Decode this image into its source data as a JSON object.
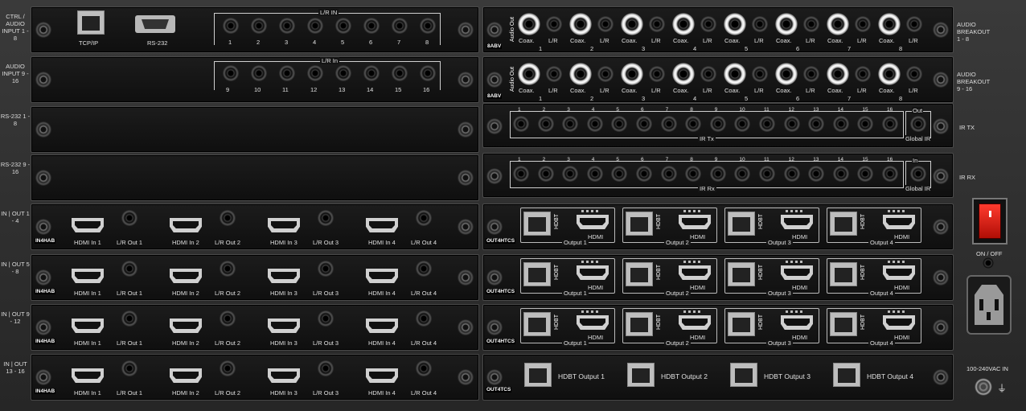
{
  "left_rows": [
    {
      "label": "CTRL / AUDIO INPUT 1 - 8"
    },
    {
      "label": "AUDIO INPUT 9 - 16"
    },
    {
      "label": "RS-232 1 - 8"
    },
    {
      "label": "RS-232 9 - 16"
    },
    {
      "label": "IN | OUT 1 - 4"
    },
    {
      "label": "IN | OUT 5 - 8"
    },
    {
      "label": "IN | OUT 9 - 12"
    },
    {
      "label": "IN | OUT 13 - 16"
    }
  ],
  "ctrl_card": {
    "tcpip": "TCP/IP",
    "rs232": "RS-232",
    "lr_in": "L/R IN",
    "nums": [
      "1",
      "2",
      "3",
      "4",
      "5",
      "6",
      "7",
      "8"
    ]
  },
  "audio_in2": {
    "lr_in": "L/R In",
    "nums": [
      "9",
      "10",
      "11",
      "12",
      "13",
      "14",
      "15",
      "16"
    ]
  },
  "input_cards": {
    "tag": "IN4HAB",
    "ports": [
      "HDMI In 1",
      "L/R Out 1",
      "HDMI In 2",
      "L/R Out 2",
      "HDMI In 3",
      "L/R Out 3",
      "HDMI In 4",
      "L/R Out 4"
    ]
  },
  "audio_out_cards": [
    {
      "tag": "8ABV",
      "vert": "Audio Out",
      "side": "AUDIO BREAKOUT 1 - 8",
      "arrow": "‹"
    },
    {
      "tag": "8ABV",
      "vert": "Audio Out",
      "side": "AUDIO BREAKOUT 9 - 16",
      "arrow": "‹"
    }
  ],
  "audio_out_labels": {
    "coax": "Coax.",
    "lr": "L/R",
    "nums": [
      "1",
      "2",
      "3",
      "4",
      "5",
      "6",
      "7",
      "8"
    ]
  },
  "ir_cards": [
    {
      "title": "IR Tx",
      "out": "Out",
      "global": "Global IR",
      "side": "IR TX"
    },
    {
      "title": "IR Rx",
      "out": "In",
      "global": "Global IR",
      "side": "IR RX"
    }
  ],
  "ir_nums": [
    "1",
    "2",
    "3",
    "4",
    "5",
    "6",
    "7",
    "8",
    "9",
    "10",
    "11",
    "12",
    "13",
    "14",
    "15",
    "16"
  ],
  "output_cards": {
    "tag": "OUT4HTCS",
    "hdbt": "HDBT",
    "hdmi": "HDMI",
    "outputs": [
      "Output 1",
      "Output 2",
      "Output 3",
      "Output 4"
    ]
  },
  "last_output_card": {
    "tag": "OUT4TCS",
    "outputs": [
      "HDBT Output 1",
      "HDBT Output 2",
      "HDBT Output 3",
      "HDBT Output 4"
    ]
  },
  "power": {
    "switch_label": "ON / OFF",
    "ac_label": "100-240VAC IN"
  },
  "colors": {
    "switch": "#e0231a",
    "panel": "#151515",
    "text": "#e6e6e6"
  }
}
